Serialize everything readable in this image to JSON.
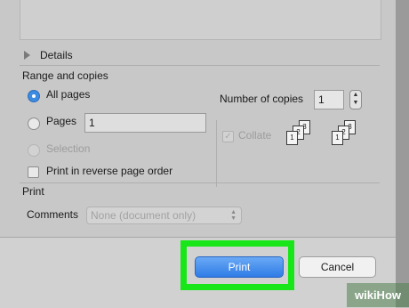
{
  "details": {
    "label": "Details"
  },
  "range": {
    "section_label": "Range and copies",
    "all_pages_label": "All pages",
    "pages_label": "Pages",
    "pages_value": "1",
    "selection_label": "Selection",
    "reverse_label": "Print in reverse page order"
  },
  "copies": {
    "label": "Number of copies",
    "value": "1",
    "collate_label": "Collate",
    "collated_icon_pages": [
      "1",
      "2",
      "3"
    ],
    "uncollated_icon_pages": [
      "1",
      "2",
      "3"
    ]
  },
  "print_section": {
    "label": "Print",
    "comments_label": "Comments",
    "comments_value": "None (document only)"
  },
  "buttons": {
    "print": "Print",
    "cancel": "Cancel"
  },
  "watermark": {
    "text": "wikiHow"
  },
  "colors": {
    "accent": "#2f7ce6",
    "highlight": "#19e619"
  }
}
